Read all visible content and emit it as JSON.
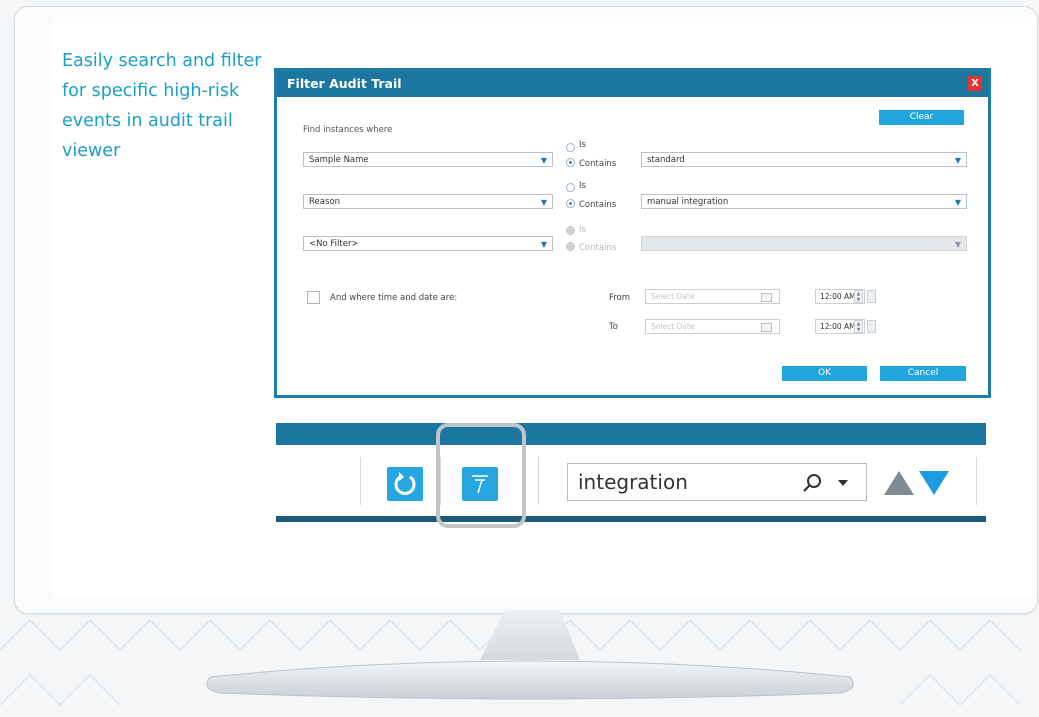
{
  "tagline": "Easily search and filter for specific high-risk events in audit trail viewer",
  "dialog": {
    "title": "Filter Audit Trail",
    "close_label": "X",
    "clear_label": "Clear",
    "find_label": "Find instances where",
    "rows": [
      {
        "field": "Sample Name",
        "is_label": "Is",
        "contains_label": "Contains",
        "selected": "Contains",
        "value": "standard"
      },
      {
        "field": "Reason",
        "is_label": "Is",
        "contains_label": "Contains",
        "selected": "Contains",
        "value": "manual integration"
      },
      {
        "field": "<No Filter>",
        "is_label": "Is",
        "contains_label": "Contains",
        "selected": "Contains",
        "value": ""
      }
    ],
    "date_checkbox_label": "And where time and date are:",
    "from_label": "From",
    "to_label": "To",
    "from_date": "Select Date",
    "to_date": "Select Date",
    "from_time": "12:00 AM",
    "to_time": "12:00 AM",
    "ok_label": "OK",
    "cancel_label": "Cancel"
  },
  "toolbar": {
    "search_value": "integration"
  },
  "colors": {
    "accent": "#1b77a0",
    "button": "#22a5dd",
    "tagline": "#1aa0c8"
  },
  "icons": [
    "refresh-icon",
    "filter-icon",
    "search-icon",
    "dropdown-icon",
    "previous-arrow-icon",
    "next-arrow-icon",
    "calendar-icon"
  ]
}
